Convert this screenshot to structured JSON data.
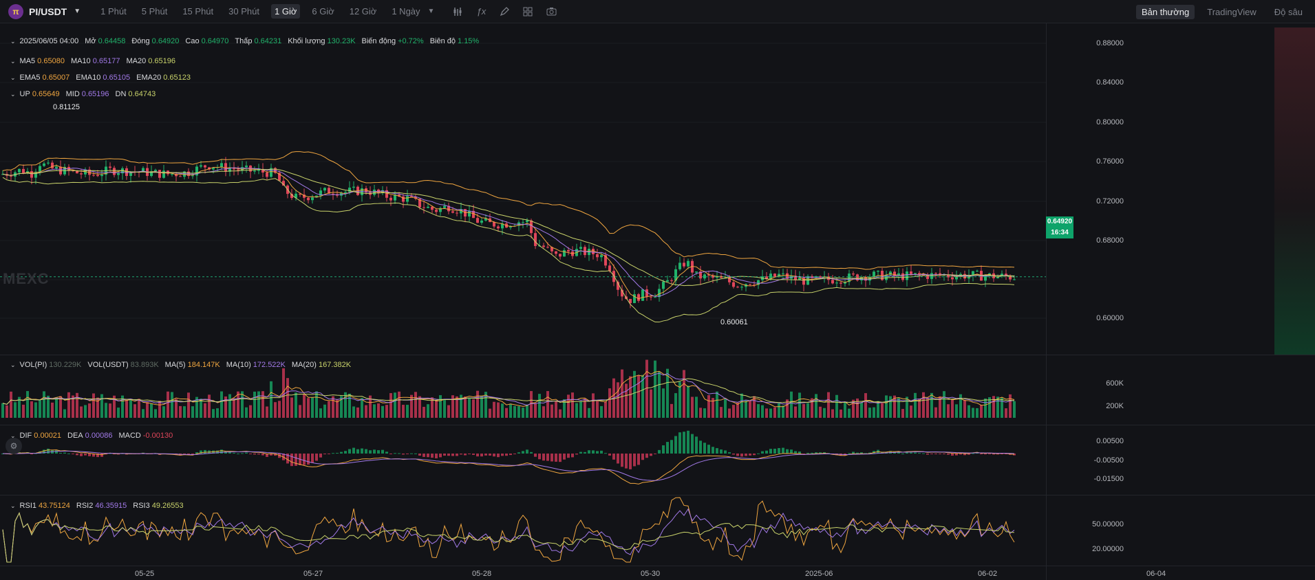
{
  "toolbar": {
    "pair": "PI/USDT",
    "timeframes": [
      "1 Phút",
      "5 Phút",
      "15 Phút",
      "30 Phút",
      "1 Giờ",
      "6 Giờ",
      "12 Giờ",
      "1 Ngày"
    ],
    "active_timeframe": "1 Giờ",
    "modes": [
      "Bản thường",
      "TradingView",
      "Độ sâu"
    ],
    "active_mode": "Bản thường",
    "icons": [
      "indicator-icon",
      "formula-icon",
      "draw-icon",
      "layout-icon",
      "camera-icon"
    ]
  },
  "ohlc": {
    "time": "2025/06/05 04:00",
    "open_label": "Mở",
    "open": "0.64458",
    "close_label": "Đóng",
    "close": "0.64920",
    "high_label": "Cao",
    "high": "0.64970",
    "low_label": "Thấp",
    "low": "0.64231",
    "volume_label": "Khối lượng",
    "volume": "130.23K",
    "change_label": "Biến động",
    "change": "+0.72%",
    "amplitude_label": "Biên độ",
    "amplitude": "1.15%"
  },
  "ma": {
    "ma5": "0.65080",
    "ma10": "0.65177",
    "ma20": "0.65196"
  },
  "ema": {
    "ema5": "0.65007",
    "ema10": "0.65105",
    "ema20": "0.65123"
  },
  "boll": {
    "up": "0.65649",
    "mid": "0.65196",
    "dn": "0.64743"
  },
  "markers": {
    "high": "0.81125",
    "low": "0.60061"
  },
  "price_tag": {
    "price": "0.64920",
    "countdown": "16:34"
  },
  "watermark": "MEXC",
  "volume": {
    "vol_pi": "130.229K",
    "vol_usdt": "83.893K",
    "ma5": "184.147K",
    "ma10": "172.522K",
    "ma20": "167.382K"
  },
  "macd": {
    "dif": "0.00021",
    "dea": "0.00086",
    "macd": "-0.00130"
  },
  "rsi": {
    "rsi1": "43.75124",
    "rsi2": "46.35915",
    "rsi3": "49.26553"
  },
  "colors": {
    "up": "#21b36b",
    "down": "#e0465a",
    "ma5": "#f0a640",
    "ma10": "#a27ae8",
    "ma20": "#c9d36b"
  },
  "chart_data": {
    "type": "candlestick",
    "price_axis_ticks": [
      "0.88000",
      "0.84000",
      "0.80000",
      "0.76000",
      "0.72000",
      "0.68000",
      "0.60000"
    ],
    "volume_axis_ticks": [
      "600K",
      "200K"
    ],
    "macd_axis_ticks": [
      "0.00500",
      "-0.00500",
      "-0.01500"
    ],
    "rsi_axis_ticks": [
      "50.00000",
      "20.00000"
    ],
    "x_ticks": [
      "05-25",
      "05-27",
      "05-28",
      "05-30",
      "2025-06",
      "06-02",
      "06-04"
    ],
    "price_path": [
      [
        0,
        0.771
      ],
      [
        30,
        0.776
      ],
      [
        45,
        0.772
      ],
      [
        55,
        0.785
      ],
      [
        70,
        0.778
      ],
      [
        100,
        0.774
      ],
      [
        130,
        0.77
      ],
      [
        160,
        0.776
      ],
      [
        200,
        0.774
      ],
      [
        240,
        0.771
      ],
      [
        270,
        0.773
      ],
      [
        300,
        0.782
      ],
      [
        330,
        0.778
      ],
      [
        360,
        0.775
      ],
      [
        390,
        0.773
      ],
      [
        400,
        0.77
      ],
      [
        410,
        0.752
      ],
      [
        430,
        0.742
      ],
      [
        460,
        0.748
      ],
      [
        480,
        0.752
      ],
      [
        500,
        0.75
      ],
      [
        530,
        0.752
      ],
      [
        560,
        0.745
      ],
      [
        590,
        0.742
      ],
      [
        610,
        0.734
      ],
      [
        630,
        0.728
      ],
      [
        650,
        0.733
      ],
      [
        670,
        0.727
      ],
      [
        690,
        0.716
      ],
      [
        710,
        0.712
      ],
      [
        730,
        0.712
      ],
      [
        750,
        0.715
      ],
      [
        765,
        0.714
      ],
      [
        775,
        0.689
      ],
      [
        790,
        0.684
      ],
      [
        805,
        0.673
      ],
      [
        820,
        0.679
      ],
      [
        835,
        0.68
      ],
      [
        850,
        0.678
      ],
      [
        870,
        0.676
      ],
      [
        885,
        0.66
      ],
      [
        895,
        0.638
      ],
      [
        905,
        0.625
      ],
      [
        915,
        0.622
      ],
      [
        930,
        0.628
      ],
      [
        950,
        0.63
      ],
      [
        965,
        0.64
      ],
      [
        980,
        0.655
      ],
      [
        995,
        0.668
      ],
      [
        1010,
        0.65
      ],
      [
        1030,
        0.648
      ],
      [
        1050,
        0.645
      ],
      [
        1070,
        0.64
      ],
      [
        1090,
        0.644
      ],
      [
        1110,
        0.646
      ],
      [
        1130,
        0.651
      ],
      [
        1150,
        0.647
      ],
      [
        1170,
        0.644
      ],
      [
        1190,
        0.645
      ],
      [
        1220,
        0.647
      ],
      [
        1260,
        0.651
      ],
      [
        1300,
        0.65
      ],
      [
        1350,
        0.651
      ],
      [
        1400,
        0.651
      ],
      [
        1440,
        0.65
      ],
      [
        1475,
        0.649
      ]
    ]
  }
}
